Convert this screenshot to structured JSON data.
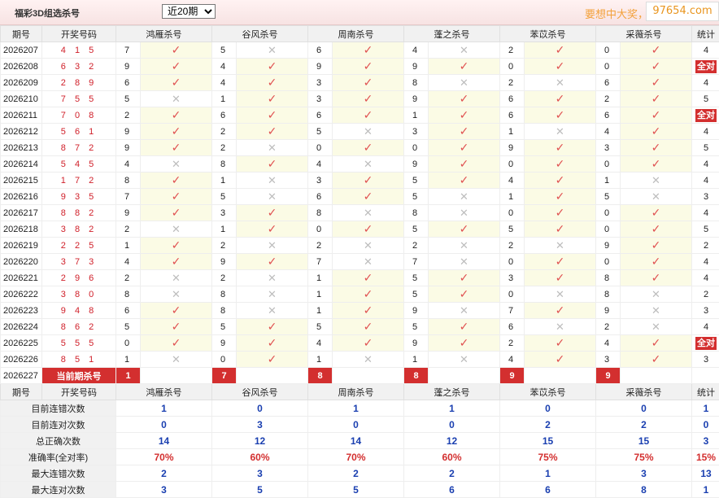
{
  "top": {
    "title": "福彩3D组选杀号",
    "period_selected": "近20期",
    "slogan": "要想中大奖，天",
    "watermark": "97654.com"
  },
  "headers": [
    "期号",
    "开奖号码",
    "鸿雁杀号",
    "谷风杀号",
    "周南杀号",
    "蓬之杀号",
    "苯苡杀号",
    "采薇杀号",
    "统计"
  ],
  "rows": [
    {
      "issue": "2026207",
      "draw": "4 1 5",
      "kills": [
        7,
        5,
        6,
        4,
        2,
        0
      ],
      "marks": [
        "Y",
        "N",
        "Y",
        "N",
        "Y",
        "Y"
      ],
      "count": "4"
    },
    {
      "issue": "2026208",
      "draw": "6 3 2",
      "kills": [
        9,
        4,
        9,
        9,
        0,
        0
      ],
      "marks": [
        "Y",
        "Y",
        "Y",
        "Y",
        "Y",
        "Y"
      ],
      "count": "全对"
    },
    {
      "issue": "2026209",
      "draw": "2 8 9",
      "kills": [
        6,
        4,
        3,
        8,
        2,
        6
      ],
      "marks": [
        "Y",
        "Y",
        "Y",
        "N",
        "N",
        "Y"
      ],
      "count": "4"
    },
    {
      "issue": "2026210",
      "draw": "7 5 5",
      "kills": [
        5,
        1,
        3,
        9,
        6,
        2
      ],
      "marks": [
        "N",
        "Y",
        "Y",
        "Y",
        "Y",
        "Y"
      ],
      "count": "5"
    },
    {
      "issue": "2026211",
      "draw": "7 0 8",
      "kills": [
        2,
        6,
        6,
        1,
        6,
        6
      ],
      "marks": [
        "Y",
        "Y",
        "Y",
        "Y",
        "Y",
        "Y"
      ],
      "count": "全对"
    },
    {
      "issue": "2026212",
      "draw": "5 6 1",
      "kills": [
        9,
        2,
        5,
        3,
        1,
        4
      ],
      "marks": [
        "Y",
        "Y",
        "N",
        "Y",
        "N",
        "Y"
      ],
      "count": "4"
    },
    {
      "issue": "2026213",
      "draw": "8 7 2",
      "kills": [
        9,
        2,
        0,
        0,
        9,
        3
      ],
      "marks": [
        "Y",
        "N",
        "Y",
        "Y",
        "Y",
        "Y"
      ],
      "count": "5"
    },
    {
      "issue": "2026214",
      "draw": "5 4 5",
      "kills": [
        4,
        8,
        4,
        9,
        0,
        0
      ],
      "marks": [
        "N",
        "Y",
        "N",
        "Y",
        "Y",
        "Y"
      ],
      "count": "4"
    },
    {
      "issue": "2026215",
      "draw": "1 7 2",
      "kills": [
        8,
        1,
        3,
        5,
        4,
        1
      ],
      "marks": [
        "Y",
        "N",
        "Y",
        "Y",
        "Y",
        "N"
      ],
      "count": "4"
    },
    {
      "issue": "2026216",
      "draw": "9 3 5",
      "kills": [
        7,
        5,
        6,
        5,
        1,
        5
      ],
      "marks": [
        "Y",
        "N",
        "Y",
        "N",
        "Y",
        "N"
      ],
      "count": "3"
    },
    {
      "issue": "2026217",
      "draw": "8 8 2",
      "kills": [
        9,
        3,
        8,
        8,
        0,
        0
      ],
      "marks": [
        "Y",
        "Y",
        "N",
        "N",
        "Y",
        "Y"
      ],
      "count": "4"
    },
    {
      "issue": "2026218",
      "draw": "3 8 2",
      "kills": [
        2,
        1,
        0,
        5,
        5,
        0
      ],
      "marks": [
        "N",
        "Y",
        "Y",
        "Y",
        "Y",
        "Y"
      ],
      "count": "5"
    },
    {
      "issue": "2026219",
      "draw": "2 2 5",
      "kills": [
        1,
        2,
        2,
        2,
        2,
        9
      ],
      "marks": [
        "Y",
        "N",
        "N",
        "N",
        "N",
        "Y"
      ],
      "count": "2"
    },
    {
      "issue": "2026220",
      "draw": "3 7 3",
      "kills": [
        4,
        9,
        7,
        7,
        0,
        0
      ],
      "marks": [
        "Y",
        "Y",
        "N",
        "N",
        "Y",
        "Y"
      ],
      "count": "4"
    },
    {
      "issue": "2026221",
      "draw": "2 9 6",
      "kills": [
        2,
        2,
        1,
        5,
        3,
        8
      ],
      "marks": [
        "N",
        "N",
        "Y",
        "Y",
        "Y",
        "Y"
      ],
      "count": "4"
    },
    {
      "issue": "2026222",
      "draw": "3 8 0",
      "kills": [
        8,
        8,
        1,
        5,
        0,
        8
      ],
      "marks": [
        "N",
        "N",
        "Y",
        "Y",
        "N",
        "N"
      ],
      "count": "2"
    },
    {
      "issue": "2026223",
      "draw": "9 4 8",
      "kills": [
        6,
        8,
        1,
        9,
        7,
        9
      ],
      "marks": [
        "Y",
        "N",
        "Y",
        "N",
        "Y",
        "N"
      ],
      "count": "3"
    },
    {
      "issue": "2026224",
      "draw": "8 6 2",
      "kills": [
        5,
        5,
        5,
        5,
        6,
        2
      ],
      "marks": [
        "Y",
        "Y",
        "Y",
        "Y",
        "N",
        "N"
      ],
      "count": "4"
    },
    {
      "issue": "2026225",
      "draw": "5 5 5",
      "kills": [
        0,
        9,
        4,
        9,
        2,
        4
      ],
      "marks": [
        "Y",
        "Y",
        "Y",
        "Y",
        "Y",
        "Y"
      ],
      "count": "全对"
    },
    {
      "issue": "2026226",
      "draw": "8 5 1",
      "kills": [
        1,
        0,
        1,
        1,
        4,
        3
      ],
      "marks": [
        "N",
        "Y",
        "N",
        "N",
        "Y",
        "Y"
      ],
      "count": "3"
    }
  ],
  "current": {
    "issue": "2026227",
    "label": "当前期杀号",
    "kills": [
      "1",
      "7",
      "8",
      "8",
      "9",
      "9"
    ]
  },
  "stats": [
    {
      "label": "目前连错次数",
      "values": [
        "1",
        "0",
        "1",
        "1",
        "0",
        "0",
        "1"
      ]
    },
    {
      "label": "目前连对次数",
      "values": [
        "0",
        "3",
        "0",
        "0",
        "2",
        "2",
        "0"
      ]
    },
    {
      "label": "总正确次数",
      "values": [
        "14",
        "12",
        "14",
        "12",
        "15",
        "15",
        "3"
      ]
    },
    {
      "label": "准确率(全对率)",
      "values": [
        "70%",
        "60%",
        "70%",
        "60%",
        "75%",
        "75%",
        "15%"
      ]
    },
    {
      "label": "最大连错次数",
      "values": [
        "2",
        "3",
        "2",
        "2",
        "1",
        "3",
        "13"
      ]
    },
    {
      "label": "最大连对次数",
      "values": [
        "3",
        "5",
        "5",
        "6",
        "6",
        "8",
        "1"
      ]
    }
  ],
  "colors": {
    "accent_red": "#d32f2f",
    "check_red": "#e05050",
    "stat_blue": "#1a3fb0",
    "slogan_orange": "#f3a13a"
  },
  "icons": {
    "correct": "check-icon",
    "wrong": "cross-icon"
  }
}
